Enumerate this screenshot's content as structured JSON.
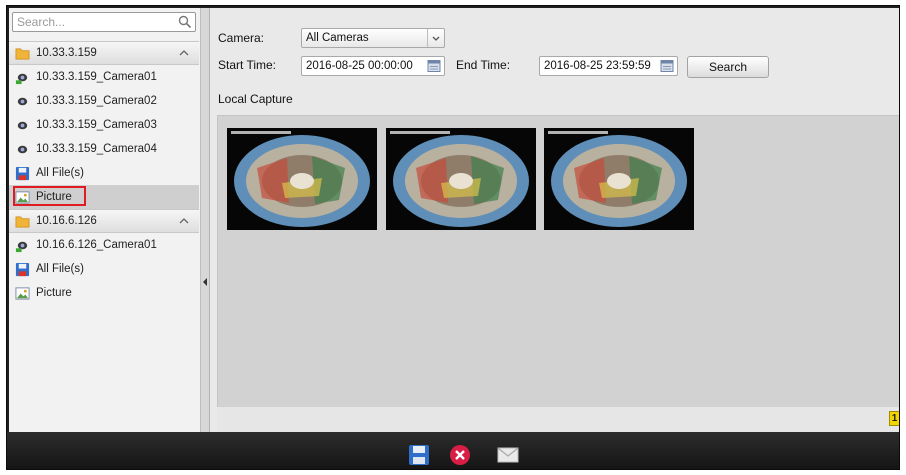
{
  "sidebar": {
    "search_placeholder": "Search...",
    "items": [
      {
        "label": "10.33.3.159",
        "type": "group",
        "icon": "folder-icon"
      },
      {
        "label": "10.33.3.159_Camera01",
        "type": "camera",
        "icon": "camera-online-icon"
      },
      {
        "label": "10.33.3.159_Camera02",
        "type": "camera",
        "icon": "camera-icon"
      },
      {
        "label": "10.33.3.159_Camera03",
        "type": "camera",
        "icon": "camera-icon"
      },
      {
        "label": "10.33.3.159_Camera04",
        "type": "camera",
        "icon": "camera-icon"
      },
      {
        "label": "All File(s)",
        "type": "files",
        "icon": "save-files-icon"
      },
      {
        "label": "Picture",
        "type": "picture",
        "icon": "picture-icon",
        "selected": true
      },
      {
        "label": "10.16.6.126",
        "type": "group",
        "icon": "folder-icon"
      },
      {
        "label": "10.16.6.126_Camera01",
        "type": "camera",
        "icon": "camera-online-icon"
      },
      {
        "label": "All File(s)",
        "type": "files",
        "icon": "save-files-icon"
      },
      {
        "label": "Picture",
        "type": "picture",
        "icon": "picture-icon"
      }
    ]
  },
  "filters": {
    "camera_label": "Camera:",
    "camera_value": "All Cameras",
    "start_label": "Start Time:",
    "start_value": "2016-08-25 00:00:00",
    "end_label": "End Time:",
    "end_value": "2016-08-25 23:59:59",
    "search_button": "Search"
  },
  "section_title": "Local Capture",
  "thumbnails": [
    {
      "name": "capture-1",
      "icon": "fisheye-image"
    },
    {
      "name": "capture-2",
      "icon": "fisheye-image"
    },
    {
      "name": "capture-3",
      "icon": "fisheye-image"
    }
  ],
  "page_badge": "1",
  "bottom_actions": [
    {
      "icon": "save-icon"
    },
    {
      "icon": "delete-icon"
    },
    {
      "icon": "email-icon"
    }
  ],
  "colors": {
    "selection_highlight": "#e11b22",
    "delete_button": "#d81e45",
    "badge": "#f1d400"
  }
}
